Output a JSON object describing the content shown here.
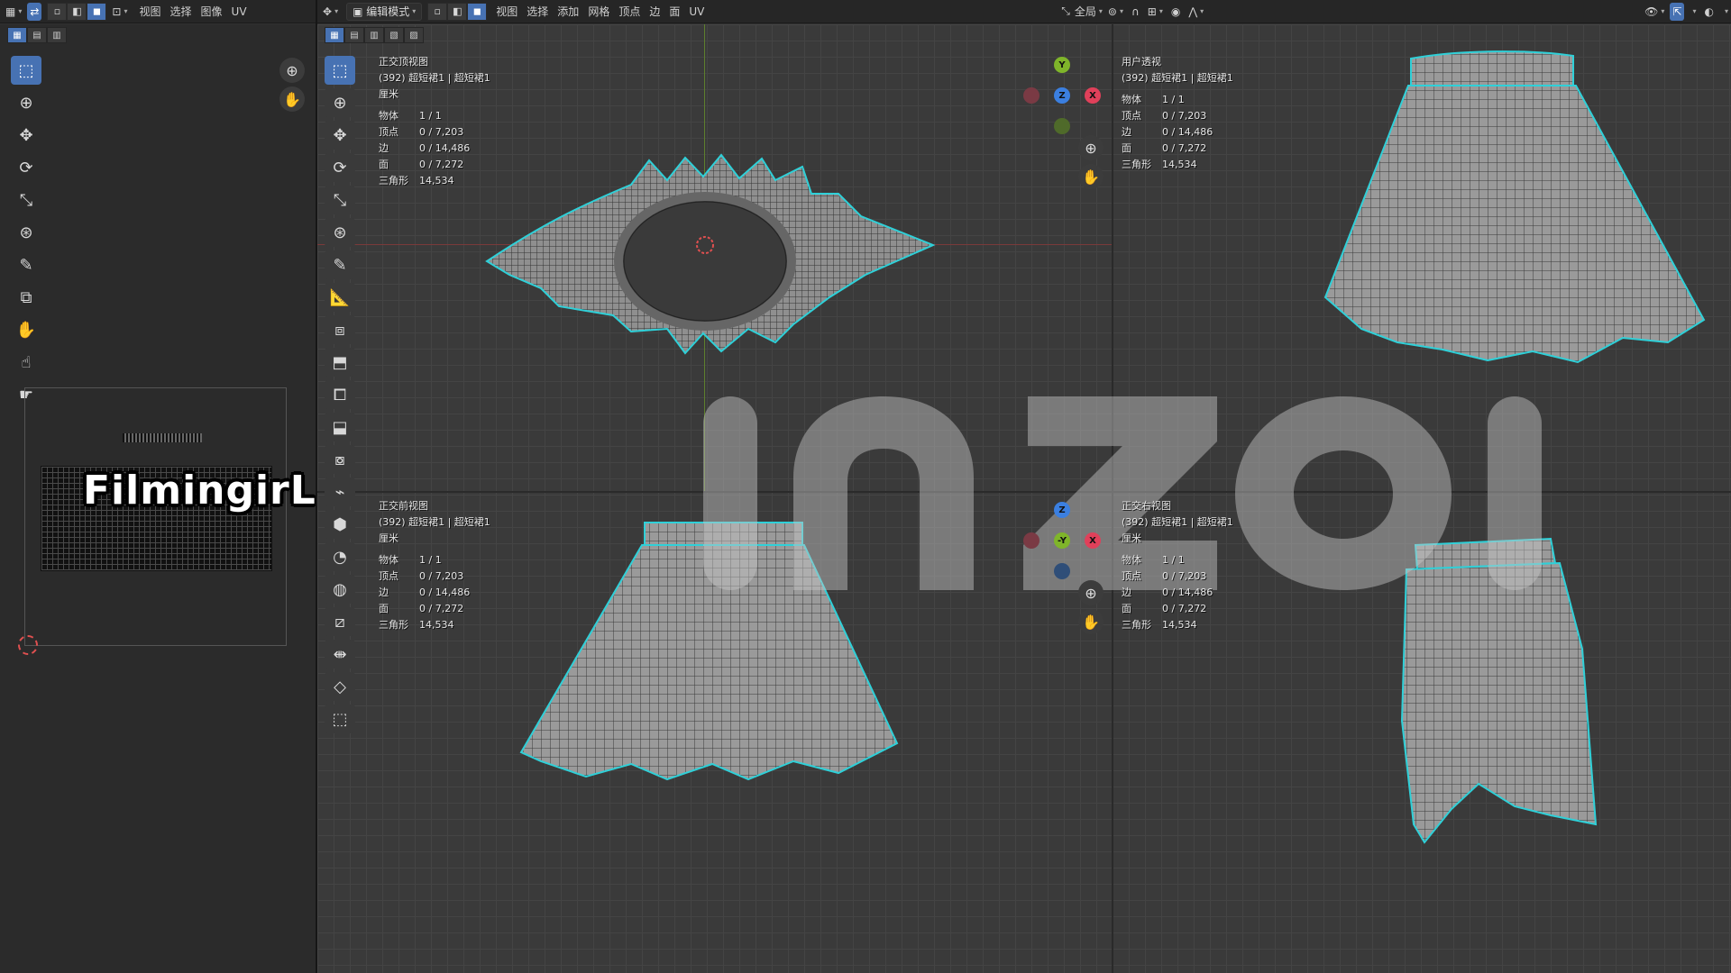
{
  "left_header": {
    "menus": [
      "视图",
      "选择",
      "图像",
      "UV"
    ]
  },
  "right_header": {
    "mode": "编辑模式",
    "menus": [
      "视图",
      "选择",
      "添加",
      "网格",
      "顶点",
      "边",
      "面",
      "UV"
    ],
    "transform_orientation": "全局"
  },
  "watermark_text": "FilmingirL·影",
  "brand_watermark": "inzoi",
  "viewports": [
    {
      "title": "正交顶视图",
      "object": "(392) 超短裙1 | 超短裙1",
      "units": "厘米",
      "stats": [
        [
          "物体",
          "1 / 1"
        ],
        [
          "顶点",
          "0 / 7,203"
        ],
        [
          "边",
          "0 / 14,486"
        ],
        [
          "面",
          "0 / 7,272"
        ],
        [
          "三角形",
          "14,534"
        ]
      ]
    },
    {
      "title": "用户透视",
      "object": "(392) 超短裙1 | 超短裙1",
      "units": "",
      "stats": [
        [
          "物体",
          "1 / 1"
        ],
        [
          "顶点",
          "0 / 7,203"
        ],
        [
          "边",
          "0 / 14,486"
        ],
        [
          "面",
          "0 / 7,272"
        ],
        [
          "三角形",
          "14,534"
        ]
      ]
    },
    {
      "title": "正交前视图",
      "object": "(392) 超短裙1 | 超短裙1",
      "units": "厘米",
      "stats": [
        [
          "物体",
          "1 / 1"
        ],
        [
          "顶点",
          "0 / 7,203"
        ],
        [
          "边",
          "0 / 14,486"
        ],
        [
          "面",
          "0 / 7,272"
        ],
        [
          "三角形",
          "14,534"
        ]
      ]
    },
    {
      "title": "正交右视图",
      "object": "(392) 超短裙1 | 超短裙1",
      "units": "厘米",
      "stats": [
        [
          "物体",
          "1 / 1"
        ],
        [
          "顶点",
          "0 / 7,203"
        ],
        [
          "边",
          "0 / 14,486"
        ],
        [
          "面",
          "0 / 7,272"
        ],
        [
          "三角形",
          "14,534"
        ]
      ]
    }
  ],
  "gizmo_top": {
    "y": "Y",
    "z": "Z",
    "x": "X"
  },
  "gizmo_right": {
    "z": "Z",
    "y": "-Y",
    "x": "X"
  },
  "colors": {
    "accent": "#4772b3",
    "mesh_highlight": "#2fd0d8",
    "axis_x": "#e0405a",
    "axis_y": "#7fb52a",
    "axis_z": "#3b7fe0"
  }
}
